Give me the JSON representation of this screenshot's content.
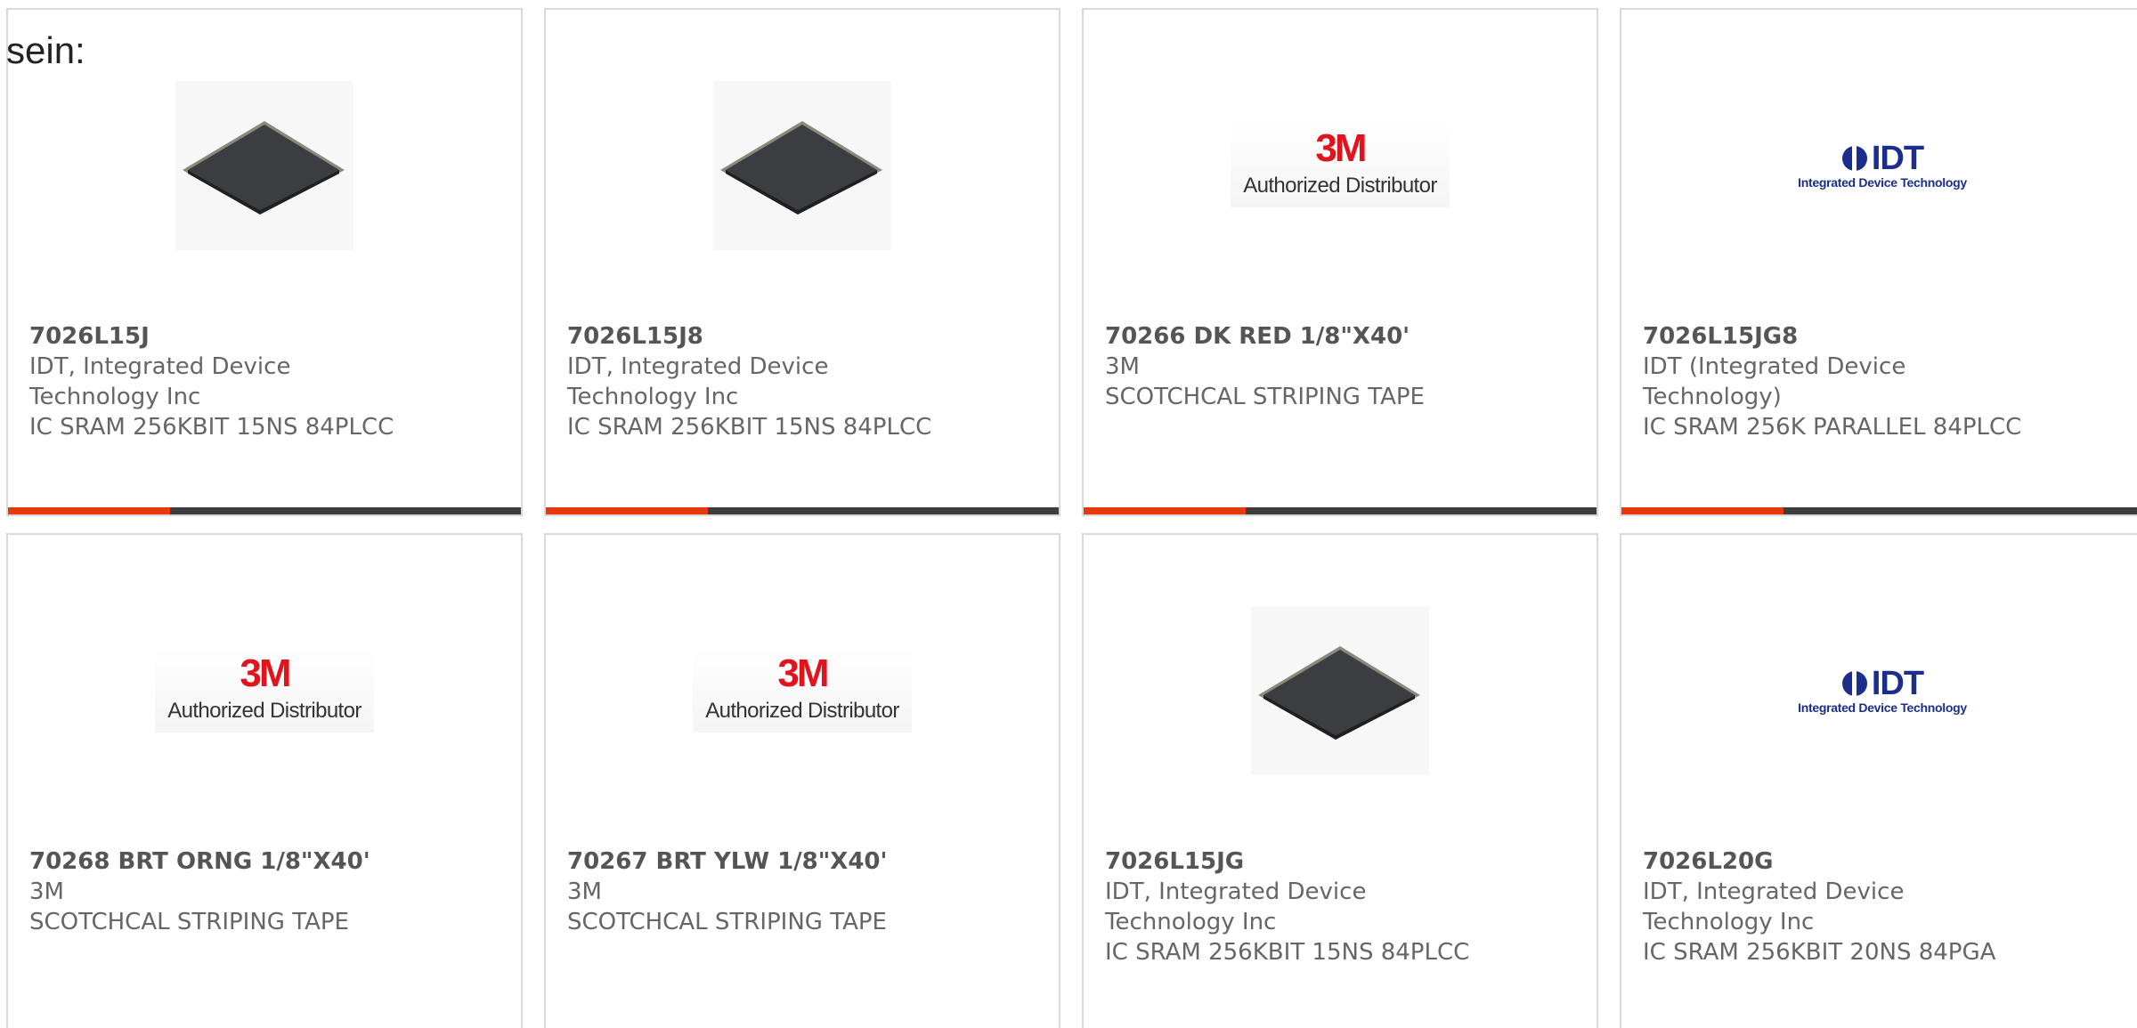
{
  "intro_text": "sein:",
  "colors": {
    "accent_bar": "#e8380d",
    "dark_bar": "#3d3d3d",
    "logo_3m_red": "#e1141e",
    "logo_idt_blue": "#1c2e8c"
  },
  "logo_text": {
    "three_m_mark": "3M",
    "three_m_sub": "Authorized Distributor",
    "idt_mark": "IDT",
    "idt_sub": "Integrated Device Technology"
  },
  "products": [
    {
      "part_number": "7026L15J",
      "manufacturer": "IDT, Integrated Device Technology Inc",
      "description": "IC SRAM 256KBIT 15NS 84PLCC",
      "image": "chip-plcc-icon"
    },
    {
      "part_number": "7026L15J8",
      "manufacturer": "IDT, Integrated Device Technology Inc",
      "description": "IC SRAM 256KBIT 15NS 84PLCC",
      "image": "chip-plcc-icon"
    },
    {
      "part_number": "70266 DK RED 1/8\"X40'",
      "manufacturer": "3M",
      "description": "SCOTCHCAL STRIPING TAPE",
      "image": "3m-logo"
    },
    {
      "part_number": "7026L15JG8",
      "manufacturer": "IDT (Integrated Device Technology)",
      "description": "IC SRAM 256K PARALLEL 84PLCC",
      "image": "idt-logo"
    },
    {
      "part_number": "70268 BRT ORNG 1/8\"X40'",
      "manufacturer": "3M",
      "description": "SCOTCHCAL STRIPING TAPE",
      "image": "3m-logo"
    },
    {
      "part_number": "70267 BRT YLW 1/8\"X40'",
      "manufacturer": "3M",
      "description": "SCOTCHCAL STRIPING TAPE",
      "image": "3m-logo"
    },
    {
      "part_number": "7026L15JG",
      "manufacturer": "IDT, Integrated Device Technology Inc",
      "description": "IC SRAM 256KBIT 15NS 84PLCC",
      "image": "chip-plcc-icon"
    },
    {
      "part_number": "7026L20G",
      "manufacturer": "IDT, Integrated Device Technology Inc",
      "description": "IC SRAM 256KBIT 20NS 84PGA",
      "image": "idt-logo"
    }
  ]
}
